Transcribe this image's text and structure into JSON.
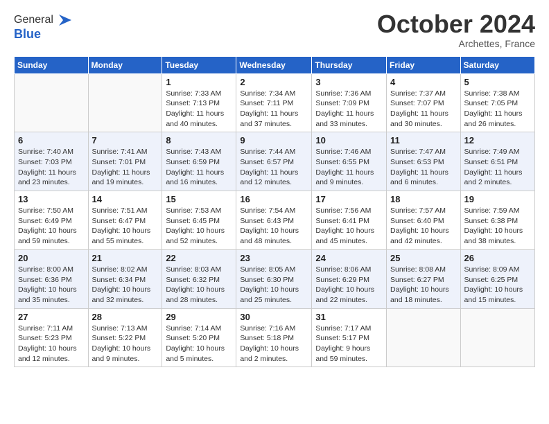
{
  "logo": {
    "general": "General",
    "blue": "Blue"
  },
  "header": {
    "month": "October 2024",
    "location": "Archettes, France"
  },
  "weekdays": [
    "Sunday",
    "Monday",
    "Tuesday",
    "Wednesday",
    "Thursday",
    "Friday",
    "Saturday"
  ],
  "weeks": [
    [
      {
        "day": "",
        "sunrise": "",
        "sunset": "",
        "daylight": ""
      },
      {
        "day": "",
        "sunrise": "",
        "sunset": "",
        "daylight": ""
      },
      {
        "day": "1",
        "sunrise": "Sunrise: 7:33 AM",
        "sunset": "Sunset: 7:13 PM",
        "daylight": "Daylight: 11 hours and 40 minutes."
      },
      {
        "day": "2",
        "sunrise": "Sunrise: 7:34 AM",
        "sunset": "Sunset: 7:11 PM",
        "daylight": "Daylight: 11 hours and 37 minutes."
      },
      {
        "day": "3",
        "sunrise": "Sunrise: 7:36 AM",
        "sunset": "Sunset: 7:09 PM",
        "daylight": "Daylight: 11 hours and 33 minutes."
      },
      {
        "day": "4",
        "sunrise": "Sunrise: 7:37 AM",
        "sunset": "Sunset: 7:07 PM",
        "daylight": "Daylight: 11 hours and 30 minutes."
      },
      {
        "day": "5",
        "sunrise": "Sunrise: 7:38 AM",
        "sunset": "Sunset: 7:05 PM",
        "daylight": "Daylight: 11 hours and 26 minutes."
      }
    ],
    [
      {
        "day": "6",
        "sunrise": "Sunrise: 7:40 AM",
        "sunset": "Sunset: 7:03 PM",
        "daylight": "Daylight: 11 hours and 23 minutes."
      },
      {
        "day": "7",
        "sunrise": "Sunrise: 7:41 AM",
        "sunset": "Sunset: 7:01 PM",
        "daylight": "Daylight: 11 hours and 19 minutes."
      },
      {
        "day": "8",
        "sunrise": "Sunrise: 7:43 AM",
        "sunset": "Sunset: 6:59 PM",
        "daylight": "Daylight: 11 hours and 16 minutes."
      },
      {
        "day": "9",
        "sunrise": "Sunrise: 7:44 AM",
        "sunset": "Sunset: 6:57 PM",
        "daylight": "Daylight: 11 hours and 12 minutes."
      },
      {
        "day": "10",
        "sunrise": "Sunrise: 7:46 AM",
        "sunset": "Sunset: 6:55 PM",
        "daylight": "Daylight: 11 hours and 9 minutes."
      },
      {
        "day": "11",
        "sunrise": "Sunrise: 7:47 AM",
        "sunset": "Sunset: 6:53 PM",
        "daylight": "Daylight: 11 hours and 6 minutes."
      },
      {
        "day": "12",
        "sunrise": "Sunrise: 7:49 AM",
        "sunset": "Sunset: 6:51 PM",
        "daylight": "Daylight: 11 hours and 2 minutes."
      }
    ],
    [
      {
        "day": "13",
        "sunrise": "Sunrise: 7:50 AM",
        "sunset": "Sunset: 6:49 PM",
        "daylight": "Daylight: 10 hours and 59 minutes."
      },
      {
        "day": "14",
        "sunrise": "Sunrise: 7:51 AM",
        "sunset": "Sunset: 6:47 PM",
        "daylight": "Daylight: 10 hours and 55 minutes."
      },
      {
        "day": "15",
        "sunrise": "Sunrise: 7:53 AM",
        "sunset": "Sunset: 6:45 PM",
        "daylight": "Daylight: 10 hours and 52 minutes."
      },
      {
        "day": "16",
        "sunrise": "Sunrise: 7:54 AM",
        "sunset": "Sunset: 6:43 PM",
        "daylight": "Daylight: 10 hours and 48 minutes."
      },
      {
        "day": "17",
        "sunrise": "Sunrise: 7:56 AM",
        "sunset": "Sunset: 6:41 PM",
        "daylight": "Daylight: 10 hours and 45 minutes."
      },
      {
        "day": "18",
        "sunrise": "Sunrise: 7:57 AM",
        "sunset": "Sunset: 6:40 PM",
        "daylight": "Daylight: 10 hours and 42 minutes."
      },
      {
        "day": "19",
        "sunrise": "Sunrise: 7:59 AM",
        "sunset": "Sunset: 6:38 PM",
        "daylight": "Daylight: 10 hours and 38 minutes."
      }
    ],
    [
      {
        "day": "20",
        "sunrise": "Sunrise: 8:00 AM",
        "sunset": "Sunset: 6:36 PM",
        "daylight": "Daylight: 10 hours and 35 minutes."
      },
      {
        "day": "21",
        "sunrise": "Sunrise: 8:02 AM",
        "sunset": "Sunset: 6:34 PM",
        "daylight": "Daylight: 10 hours and 32 minutes."
      },
      {
        "day": "22",
        "sunrise": "Sunrise: 8:03 AM",
        "sunset": "Sunset: 6:32 PM",
        "daylight": "Daylight: 10 hours and 28 minutes."
      },
      {
        "day": "23",
        "sunrise": "Sunrise: 8:05 AM",
        "sunset": "Sunset: 6:30 PM",
        "daylight": "Daylight: 10 hours and 25 minutes."
      },
      {
        "day": "24",
        "sunrise": "Sunrise: 8:06 AM",
        "sunset": "Sunset: 6:29 PM",
        "daylight": "Daylight: 10 hours and 22 minutes."
      },
      {
        "day": "25",
        "sunrise": "Sunrise: 8:08 AM",
        "sunset": "Sunset: 6:27 PM",
        "daylight": "Daylight: 10 hours and 18 minutes."
      },
      {
        "day": "26",
        "sunrise": "Sunrise: 8:09 AM",
        "sunset": "Sunset: 6:25 PM",
        "daylight": "Daylight: 10 hours and 15 minutes."
      }
    ],
    [
      {
        "day": "27",
        "sunrise": "Sunrise: 7:11 AM",
        "sunset": "Sunset: 5:23 PM",
        "daylight": "Daylight: 10 hours and 12 minutes."
      },
      {
        "day": "28",
        "sunrise": "Sunrise: 7:13 AM",
        "sunset": "Sunset: 5:22 PM",
        "daylight": "Daylight: 10 hours and 9 minutes."
      },
      {
        "day": "29",
        "sunrise": "Sunrise: 7:14 AM",
        "sunset": "Sunset: 5:20 PM",
        "daylight": "Daylight: 10 hours and 5 minutes."
      },
      {
        "day": "30",
        "sunrise": "Sunrise: 7:16 AM",
        "sunset": "Sunset: 5:18 PM",
        "daylight": "Daylight: 10 hours and 2 minutes."
      },
      {
        "day": "31",
        "sunrise": "Sunrise: 7:17 AM",
        "sunset": "Sunset: 5:17 PM",
        "daylight": "Daylight: 9 hours and 59 minutes."
      },
      {
        "day": "",
        "sunrise": "",
        "sunset": "",
        "daylight": ""
      },
      {
        "day": "",
        "sunrise": "",
        "sunset": "",
        "daylight": ""
      }
    ]
  ]
}
